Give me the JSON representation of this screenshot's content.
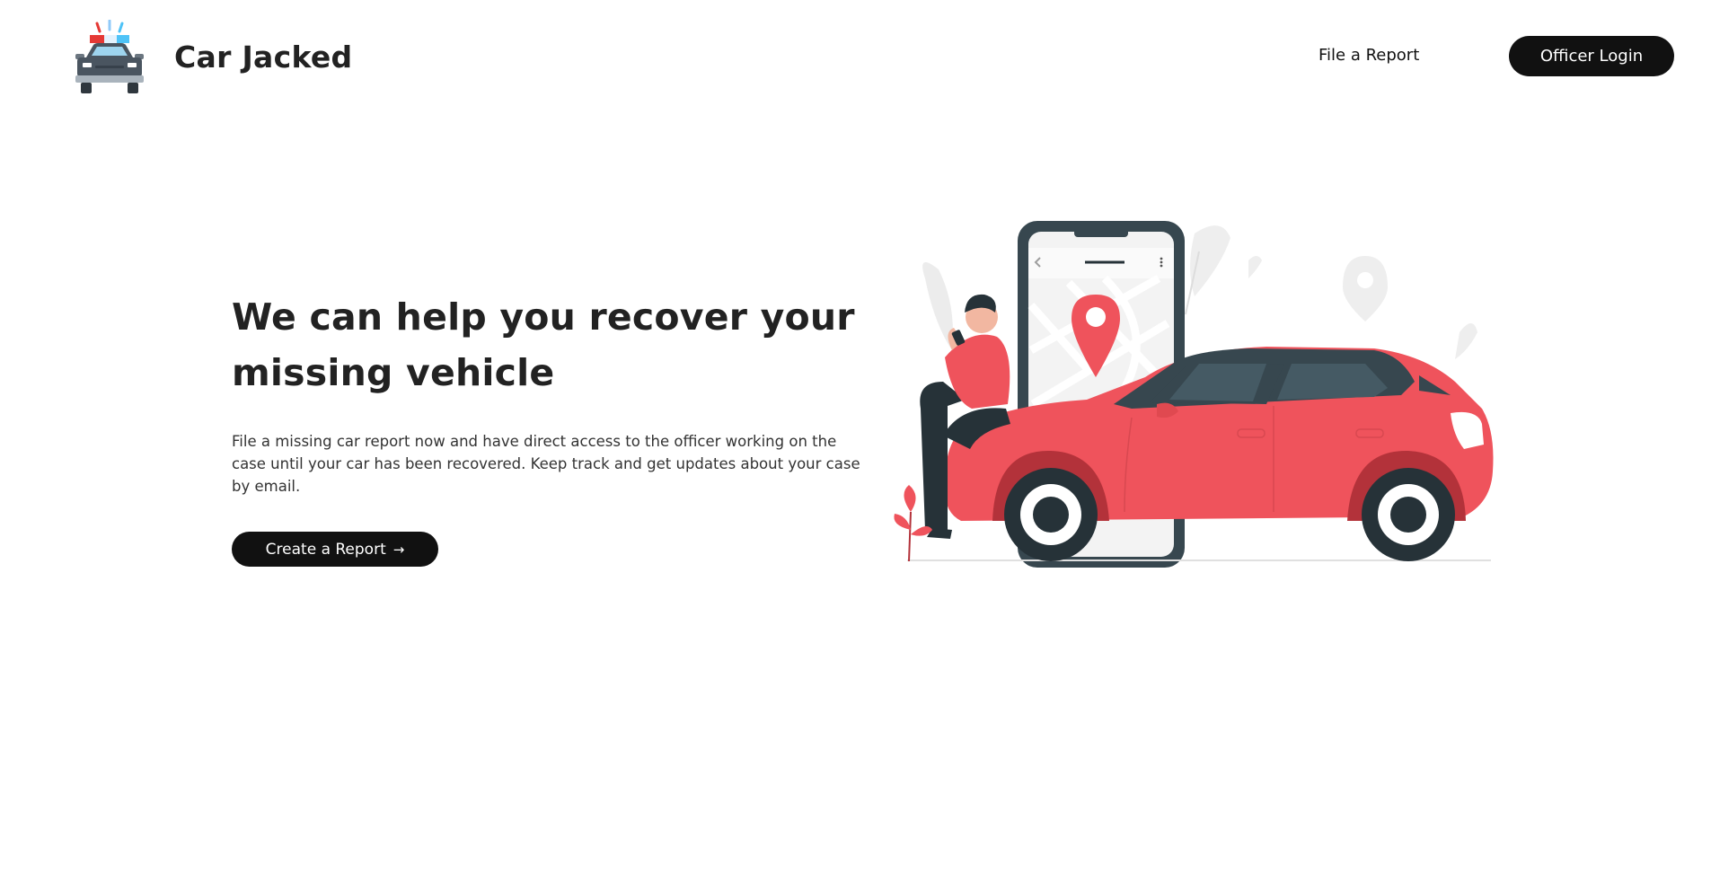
{
  "header": {
    "brand": "Car Jacked",
    "logo_icon": "police-car-icon",
    "nav": {
      "file_report_label": "File a Report",
      "officer_login_label": "Officer Login"
    }
  },
  "hero": {
    "heading": "We can help you recover your missing vehicle",
    "description": "File a missing car report now and have direct access to the officer working on the case until your car has been recovered. Keep track and get updates about your case by email.",
    "cta_label": "Create a Report",
    "cta_arrow": "→",
    "illustration_icon": "man-with-car-and-phone-map-illustration"
  },
  "colors": {
    "accent_red": "#ef535c",
    "dark": "#111111",
    "slate": "#37474f"
  }
}
